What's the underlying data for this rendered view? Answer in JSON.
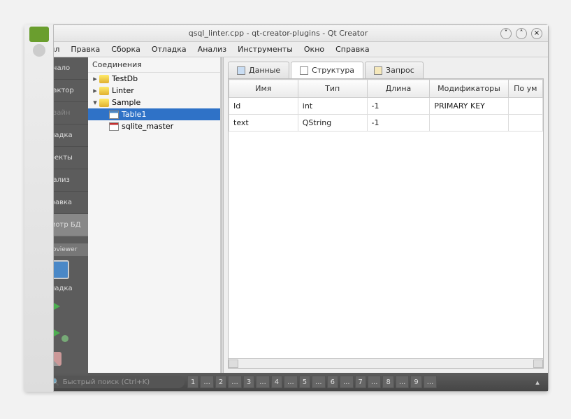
{
  "window": {
    "title": "qsql_linter.cpp - qt-creator-plugins - Qt Creator"
  },
  "menu": {
    "file": "Файл",
    "edit": "Правка",
    "build": "Сборка",
    "debug": "Отладка",
    "analyze": "Анализ",
    "tools": "Инструменты",
    "window": "Окно",
    "help": "Справка"
  },
  "leftbar": {
    "welcome": "Начало",
    "editor": "Редактор",
    "design": "Дизайн",
    "debug": "Отладка",
    "projects": "Проекты",
    "analyze": "Анализ",
    "help": "Справка",
    "dbview": "Просмотр БД",
    "proj_sub": "qtc-dbviewer",
    "target": "Отладка"
  },
  "connections": {
    "title": "Соединения",
    "items": [
      {
        "name": "TestDb",
        "expanded": false
      },
      {
        "name": "Linter",
        "expanded": false
      },
      {
        "name": "Sample",
        "expanded": true,
        "children": [
          {
            "name": "Table1",
            "selected": true,
            "icon": "tbl"
          },
          {
            "name": "sqlite_master",
            "icon": "tbl-r"
          }
        ]
      }
    ]
  },
  "tabs": {
    "data": "Данные",
    "struct": "Структура",
    "query": "Запрос",
    "active": "struct"
  },
  "columns": {
    "name": "Имя",
    "type": "Тип",
    "len": "Длина",
    "mods": "Модификаторы",
    "default": "По ум"
  },
  "rows": [
    {
      "name": "Id",
      "type": "int",
      "len": "-1",
      "mods": "PRIMARY KEY"
    },
    {
      "name": "text",
      "type": "QString",
      "len": "-1",
      "mods": ""
    }
  ],
  "bottom": {
    "search_placeholder": "Быстрый поиск (Ctrl+K)",
    "locs": [
      "1",
      "...",
      "2",
      "...",
      "3",
      "...",
      "4",
      "...",
      "5",
      "...",
      "6",
      "...",
      "7",
      "...",
      "8",
      "...",
      "9",
      "..."
    ]
  }
}
